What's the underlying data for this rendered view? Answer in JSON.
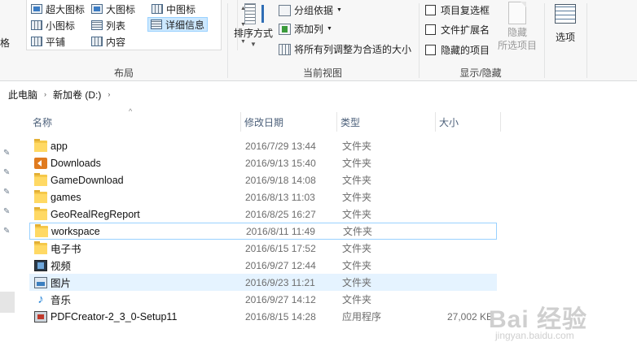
{
  "ribbon": {
    "left_cut_text": "格",
    "layout": {
      "group_label": "布局",
      "items": [
        {
          "label": "超大图标",
          "icon": "extra-large-icons-icon"
        },
        {
          "label": "大图标",
          "icon": "large-icons-icon"
        },
        {
          "label": "中图标",
          "icon": "medium-icons-icon"
        },
        {
          "label": "小图标",
          "icon": "small-icons-icon"
        },
        {
          "label": "列表",
          "icon": "list-view-icon"
        },
        {
          "label": "详细信息",
          "icon": "details-view-icon",
          "selected": true
        },
        {
          "label": "平铺",
          "icon": "tiles-view-icon"
        },
        {
          "label": "内容",
          "icon": "content-view-icon"
        }
      ]
    },
    "current_view": {
      "group_label": "当前视图",
      "sort_label": "排序方式",
      "group_by": "分组依据",
      "add_column": "添加列",
      "fit_columns": "将所有列调整为合适的大小"
    },
    "show_hide": {
      "group_label": "显示/隐藏",
      "item_checkboxes": "项目复选框",
      "file_extensions": "文件扩展名",
      "hidden_items": "隐藏的项目",
      "hide_selected_line1": "隐藏",
      "hide_selected_line2": "所选项目"
    },
    "options_label": "选项"
  },
  "address": {
    "crumbs": [
      "此电脑",
      "新加卷 (D:)"
    ]
  },
  "columns": {
    "name": "名称",
    "date": "修改日期",
    "type": "类型",
    "size": "大小"
  },
  "files": [
    {
      "name": "app",
      "date": "2016/7/29 13:44",
      "type": "文件夹",
      "size": "",
      "icon": "folder-icon"
    },
    {
      "name": "Downloads",
      "date": "2016/9/13 15:40",
      "type": "文件夹",
      "size": "",
      "icon": "downloads-folder-icon"
    },
    {
      "name": "GameDownload",
      "date": "2016/9/18 14:08",
      "type": "文件夹",
      "size": "",
      "icon": "folder-icon"
    },
    {
      "name": "games",
      "date": "2016/8/13 11:03",
      "type": "文件夹",
      "size": "",
      "icon": "folder-icon"
    },
    {
      "name": "GeoRealRegReport",
      "date": "2016/8/25 16:27",
      "type": "文件夹",
      "size": "",
      "icon": "folder-icon"
    },
    {
      "name": "workspace",
      "date": "2016/8/11 11:49",
      "type": "文件夹",
      "size": "",
      "icon": "folder-icon"
    },
    {
      "name": "电子书",
      "date": "2016/6/15 17:52",
      "type": "文件夹",
      "size": "",
      "icon": "folder-icon"
    },
    {
      "name": "视频",
      "date": "2016/9/27 12:44",
      "type": "文件夹",
      "size": "",
      "icon": "video-folder-icon"
    },
    {
      "name": "图片",
      "date": "2016/9/23 11:21",
      "type": "文件夹",
      "size": "",
      "icon": "pictures-folder-icon"
    },
    {
      "name": "音乐",
      "date": "2016/9/27 14:12",
      "type": "文件夹",
      "size": "",
      "icon": "music-folder-icon"
    },
    {
      "name": "PDFCreator-2_3_0-Setup11",
      "date": "2016/8/15 14:28",
      "type": "应用程序",
      "size": "27,002 KB",
      "icon": "setup-exe-icon"
    }
  ],
  "watermark": {
    "main": "Bai 经验",
    "sub": "jingyan.baidu.com"
  },
  "colors": {
    "selection": "#cce8ff",
    "hover_row": "#e5f3ff",
    "focus_border": "#99d1ff",
    "folder": "#ffd964",
    "header_text": "#4c607a"
  }
}
